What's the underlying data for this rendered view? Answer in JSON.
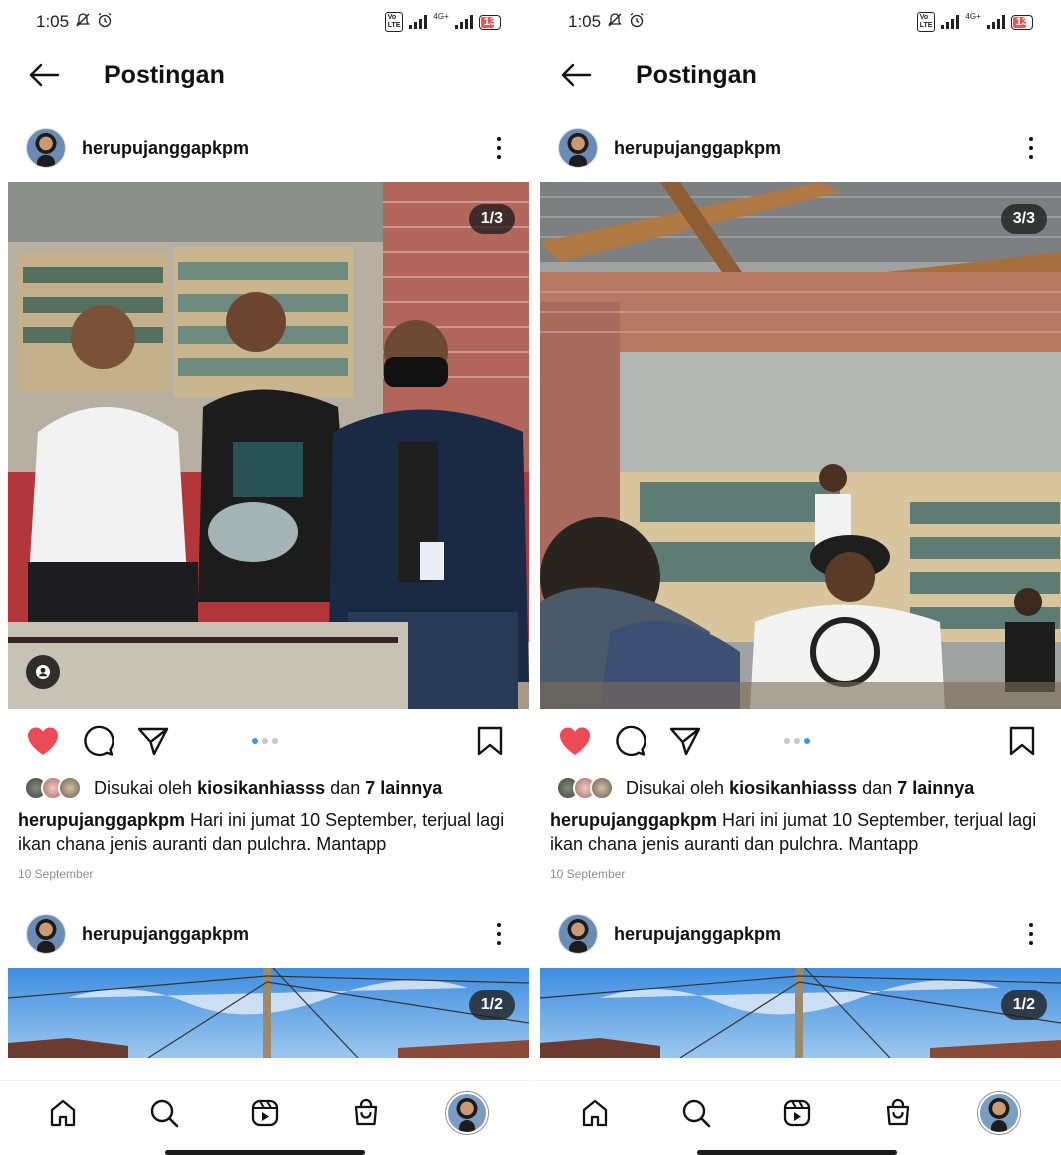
{
  "screens": [
    {
      "status": {
        "time": "1:05",
        "battery": "13",
        "network": "4G+"
      },
      "header": {
        "title": "Postingan"
      },
      "post1": {
        "username": "herupujanggapkpm",
        "counter": "1/3",
        "active_dot": 0,
        "likes_prefix": "Disukai oleh",
        "likes_user": "kiosikanhiasss",
        "likes_and": "dan",
        "likes_others": "7 lainnya",
        "caption_user": "herupujanggapkpm",
        "caption_text": "Hari ini jumat 10 September, terjual lagi ikan chana jenis auranti dan pulchra. Mantapp",
        "date": "10 September"
      },
      "post2": {
        "username": "herupujanggapkpm",
        "counter": "1/2"
      }
    },
    {
      "status": {
        "time": "1:05",
        "battery": "13",
        "network": "4G+"
      },
      "header": {
        "title": "Postingan"
      },
      "post1": {
        "username": "herupujanggapkpm",
        "counter": "3/3",
        "active_dot": 2,
        "likes_prefix": "Disukai oleh",
        "likes_user": "kiosikanhiasss",
        "likes_and": "dan",
        "likes_others": "7 lainnya",
        "caption_user": "herupujanggapkpm",
        "caption_text": "Hari ini jumat 10 September, terjual lagi ikan chana jenis auranti dan pulchra. Mantapp",
        "date": "10 September"
      },
      "post2": {
        "username": "herupujanggapkpm",
        "counter": "1/2"
      }
    }
  ],
  "icons": {
    "back": "arrow-left-icon",
    "more": "more-vertical-icon",
    "like": "heart-icon",
    "comment": "comment-icon",
    "share": "send-icon",
    "save": "bookmark-icon",
    "tag": "user-tag-icon",
    "nav": [
      "home-icon",
      "search-icon",
      "reels-icon",
      "shop-icon",
      "profile-avatar"
    ]
  },
  "colors": {
    "like_red": "#ed4956",
    "dot_active": "#3897f0",
    "dot_inactive": "#c7c7c7",
    "date_gray": "#8e8e8e"
  }
}
